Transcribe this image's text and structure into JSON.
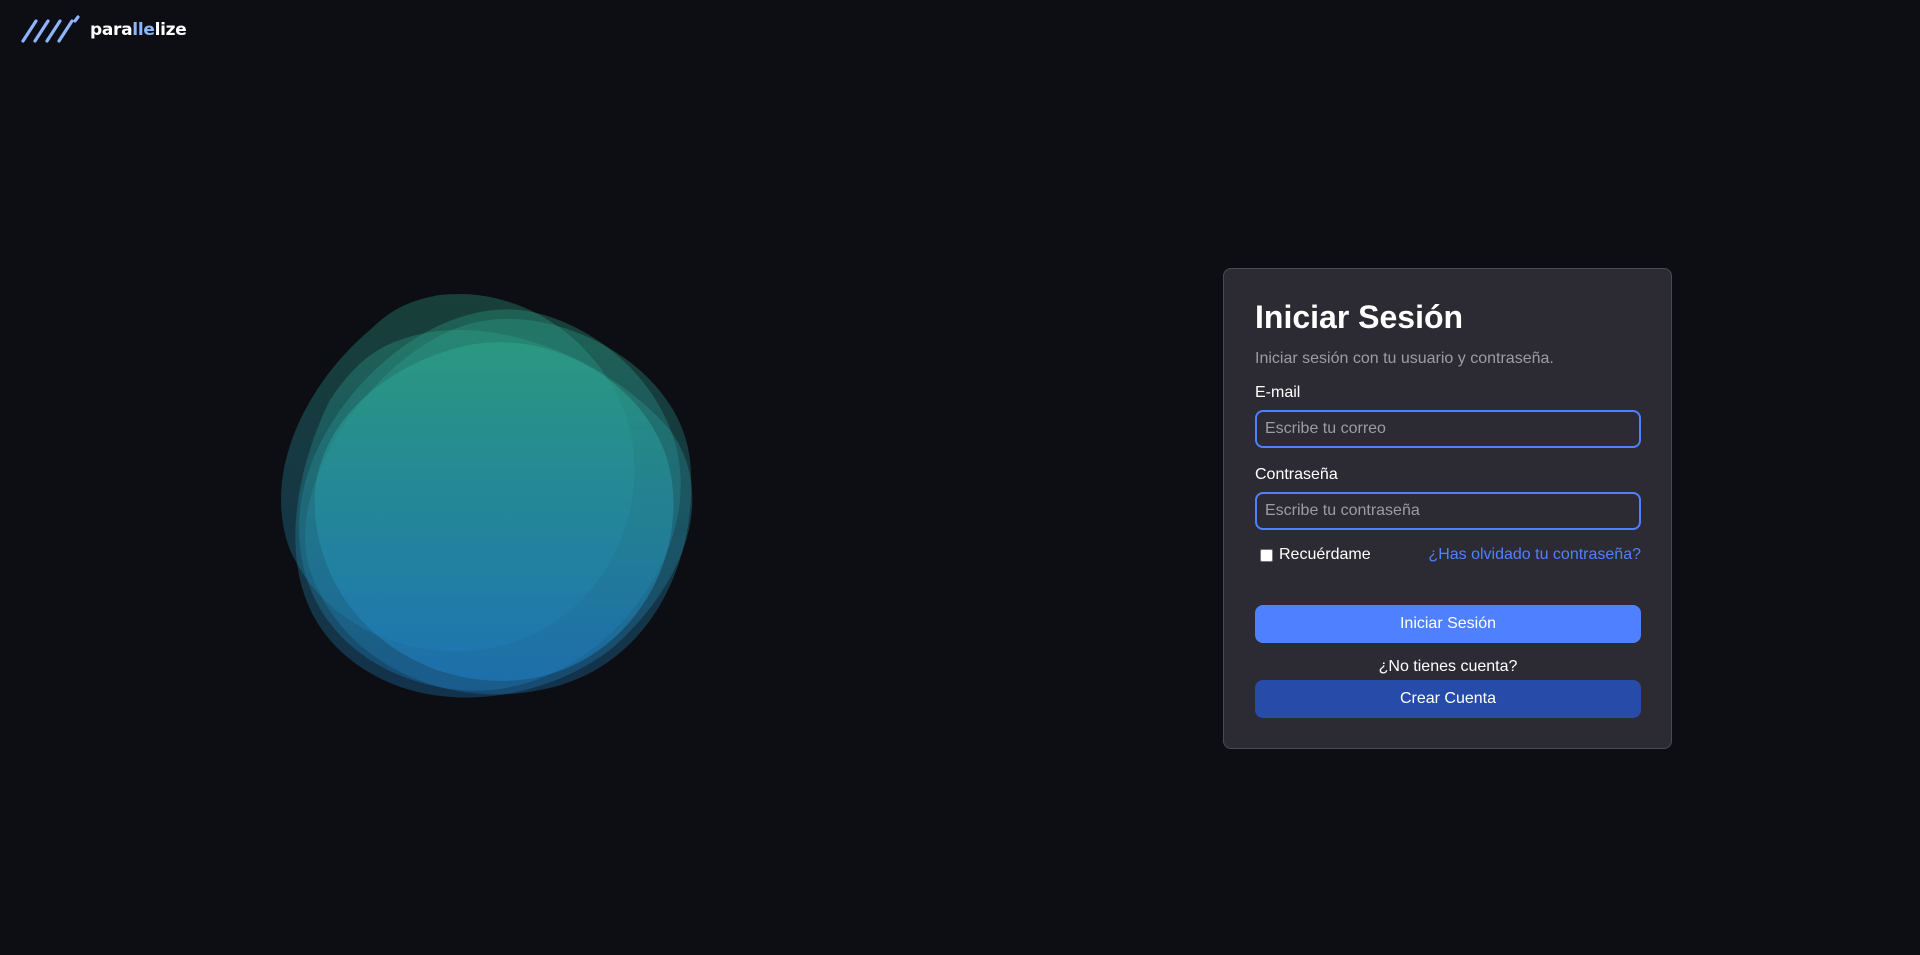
{
  "brand": {
    "name_start": "para",
    "name_accent": "lle",
    "name_end": "lize",
    "accent_color": "#8fb4ff"
  },
  "login": {
    "title": "Iniciar Sesión",
    "subtitle": "Iniciar sesión con tu usuario y contraseña.",
    "email_label": "E-mail",
    "email_placeholder": "Escribe tu correo",
    "email_value": "",
    "password_label": "Contraseña",
    "password_placeholder": "Escribe tu contraseña",
    "password_value": "",
    "remember_label": "Recuérdame",
    "remember_checked": false,
    "forgot_link": "¿Has olvidado tu contraseña?",
    "submit_label": "Iniciar Sesión",
    "no_account_text": "¿No tienes cuenta?",
    "create_account_label": "Crear Cuenta"
  },
  "colors": {
    "background": "#0d0e13",
    "card": "#2c2b33",
    "primary": "#4f80ff",
    "secondary": "#274ba8",
    "blob_top": "#2ea88a",
    "blob_bottom": "#1f7ec4"
  }
}
